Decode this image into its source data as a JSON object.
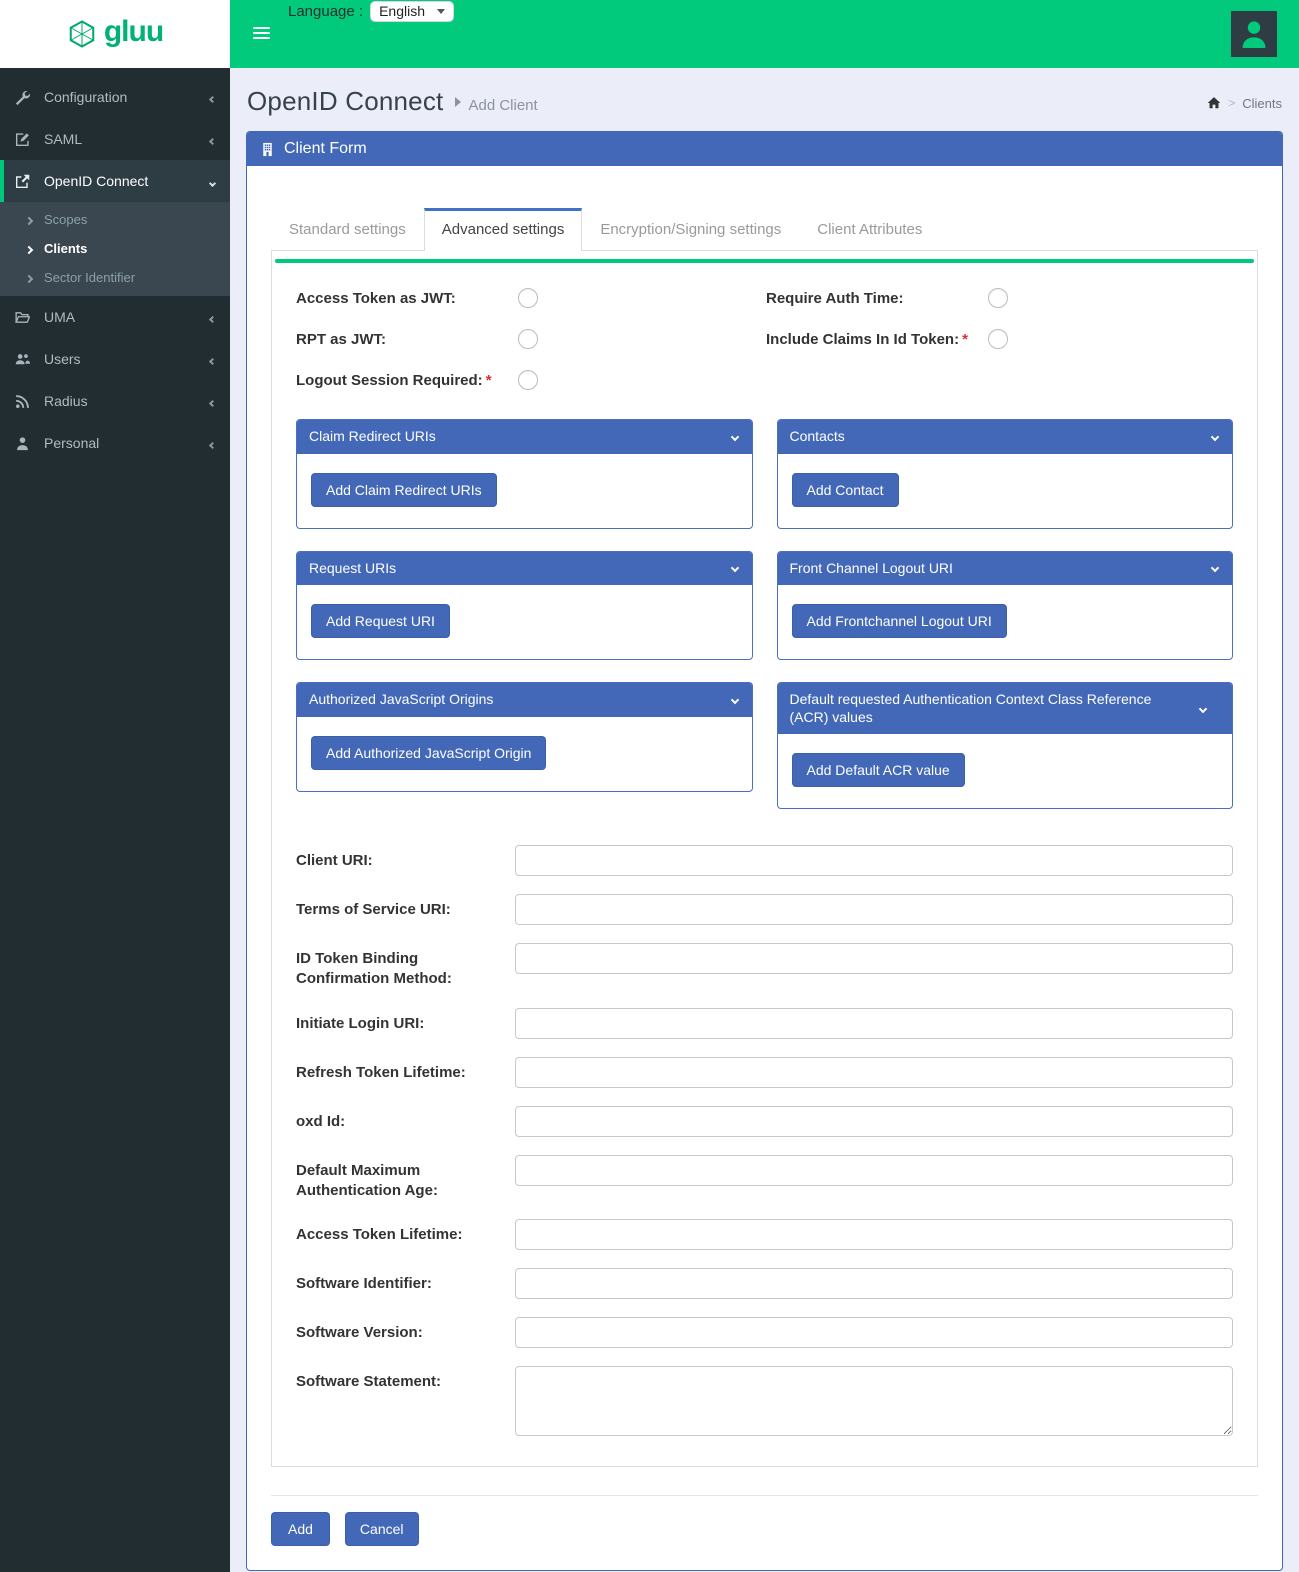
{
  "brand": {
    "name": "gluu"
  },
  "header": {
    "language_label": "Language :",
    "language_value": "English"
  },
  "sidebar": {
    "items": [
      {
        "label": "Configuration"
      },
      {
        "label": "SAML"
      },
      {
        "label": "OpenID Connect"
      },
      {
        "label": "UMA"
      },
      {
        "label": "Users"
      },
      {
        "label": "Radius"
      },
      {
        "label": "Personal"
      }
    ],
    "openid_submenu": [
      {
        "label": "Scopes"
      },
      {
        "label": "Clients"
      },
      {
        "label": "Sector Identifier"
      }
    ]
  },
  "page": {
    "title": "OpenID Connect",
    "subtitle": "Add Client",
    "breadcrumb_separator": ">",
    "breadcrumb_current": "Clients"
  },
  "panel": {
    "title": "Client Form"
  },
  "tabs": [
    {
      "label": "Standard settings"
    },
    {
      "label": "Advanced settings"
    },
    {
      "label": "Encryption/Signing settings"
    },
    {
      "label": "Client Attributes"
    }
  ],
  "toggles": {
    "left": [
      {
        "label": "Access Token as JWT:"
      },
      {
        "label": "RPT as JWT:"
      },
      {
        "label": "Logout Session Required:",
        "required": "*"
      }
    ],
    "right": [
      {
        "label": "Require Auth Time:"
      },
      {
        "label": "Include Claims In Id Token:",
        "required": "*"
      }
    ]
  },
  "sections": [
    {
      "title": "Claim Redirect URIs",
      "button": "Add Claim Redirect URIs"
    },
    {
      "title": "Contacts",
      "button": "Add Contact"
    },
    {
      "title": "Request URIs",
      "button": "Add Request URI"
    },
    {
      "title": "Front Channel Logout URI",
      "button": "Add Frontchannel Logout URI"
    },
    {
      "title": "Authorized JavaScript Origins",
      "button": "Add Authorized JavaScript Origin"
    },
    {
      "title": "Default requested Authentication Context Class Reference (ACR) values",
      "button": "Add Default ACR value"
    }
  ],
  "fields": [
    {
      "label": "Client URI:"
    },
    {
      "label": "Terms of Service URI:"
    },
    {
      "label": "ID Token Binding Confirmation Method:"
    },
    {
      "label": "Initiate Login URI:"
    },
    {
      "label": "Refresh Token Lifetime:"
    },
    {
      "label": "oxd Id:"
    },
    {
      "label": "Default Maximum Authentication Age:"
    },
    {
      "label": "Access Token Lifetime:"
    },
    {
      "label": "Software Identifier:"
    },
    {
      "label": "Software Version:"
    },
    {
      "label": "Software Statement:"
    }
  ],
  "actions": {
    "add": "Add",
    "cancel": "Cancel"
  },
  "colors": {
    "brand_green": "#02ca7c",
    "panel_blue": "#4368b8",
    "sidebar_dark": "#222d32",
    "required_red": "#dd2c2c"
  }
}
